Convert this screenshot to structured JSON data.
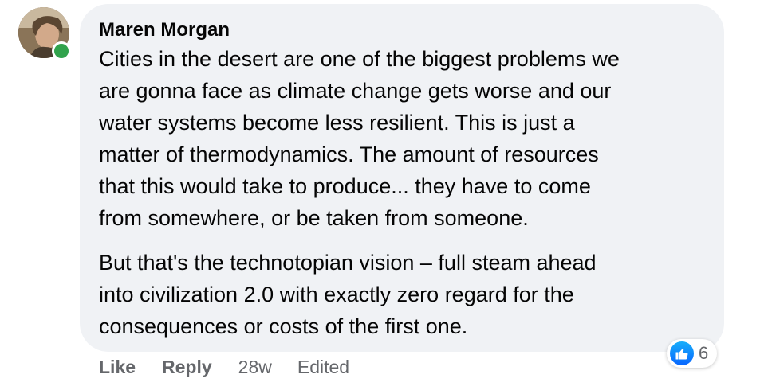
{
  "comment": {
    "author": "Maren Morgan",
    "online": true,
    "paragraphs": [
      "Cities in the desert are one of the biggest problems we\nare gonna face as climate change gets worse and our\nwater systems become less resilient. This is just a\nmatter of thermodynamics. The amount of resources\nthat this would take to produce... they have to come\nfrom somewhere, or be taken from someone.",
      "But that's the technotopian vision – full steam ahead\ninto civilization 2.0 with exactly zero regard for the\nconsequences or costs of the first one."
    ],
    "reaction_icon": "like-icon",
    "reaction_count": "6"
  },
  "actions": {
    "like_label": "Like",
    "reply_label": "Reply",
    "timestamp": "28w",
    "edited_label": "Edited"
  },
  "colors": {
    "bubble": "#f0f2f5",
    "presence": "#31a24c",
    "like_blue": "#0866ff",
    "meta_gray": "#65676b"
  }
}
